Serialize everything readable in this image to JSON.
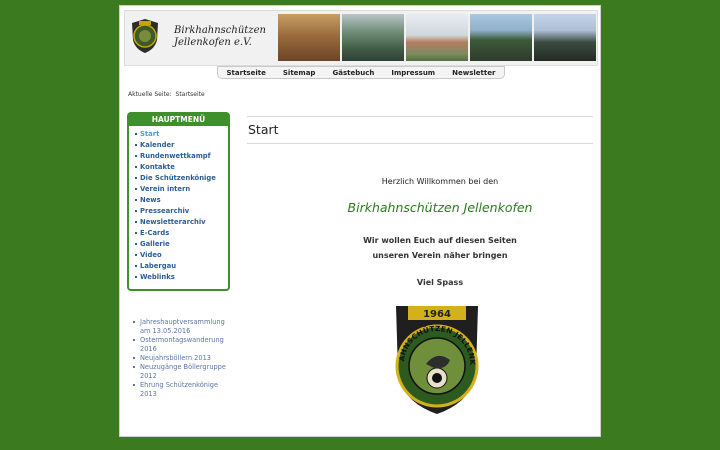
{
  "header": {
    "title_line1": "Birkhahnschützen",
    "title_line2": "Jellenkofen e.V."
  },
  "nav": {
    "items": [
      "Startseite",
      "Sitemap",
      "Gästebuch",
      "Impressum",
      "Newsletter"
    ]
  },
  "breadcrumb": {
    "label": "Aktuelle Seite:",
    "current": "Startseite"
  },
  "sidebar": {
    "menu_title": "HAUPTMENÜ",
    "items": [
      "Start",
      "Kalender",
      "Rundenwettkampf",
      "Kontakte",
      "Die Schützenkönige",
      "Verein intern",
      "News",
      "Pressearchiv",
      "Newsletterarchiv",
      "E-Cards",
      "Gallerie",
      "Video",
      "Labergau",
      "Weblinks"
    ],
    "news": [
      "Jahreshauptversammlung am 13.05.2016",
      "Ostermontagswanderung 2016",
      "Neujahrsböllern 2013",
      "Neuzugänge Böllergruppe 2012",
      "Ehrung Schützenkönige 2013"
    ]
  },
  "main": {
    "title": "Start",
    "welcome": "Herzlich Willkommen bei den",
    "club_name": "Birkhahnschützen Jellenkofen",
    "intro_line1": "Wir wollen Euch auf diesen Seiten",
    "intro_line2": "unseren Verein näher bringen",
    "fun": "Viel Spass"
  },
  "emblem": {
    "year": "1964",
    "text": "BIRKHAHNSCHÜTZEN JELLENKOFEN"
  },
  "colors": {
    "background": "#3b7a1f",
    "accent": "#3f8f2a",
    "menu_link": "#2b5d95",
    "club_name": "#2a7a1e"
  }
}
